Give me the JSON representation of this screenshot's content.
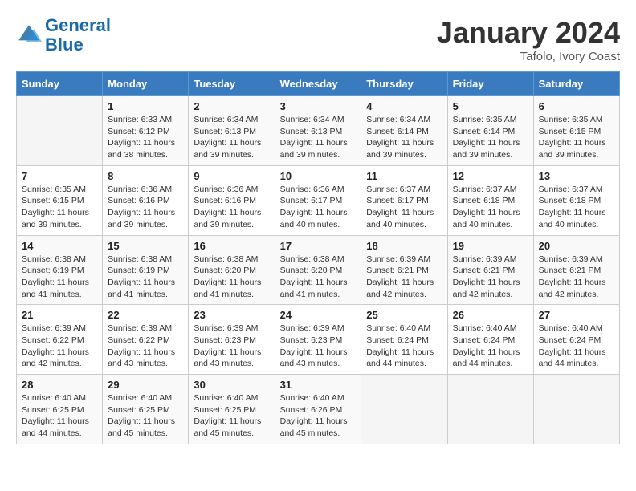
{
  "header": {
    "logo_line1": "General",
    "logo_line2": "Blue",
    "month_title": "January 2024",
    "subtitle": "Tafolo, Ivory Coast"
  },
  "days_of_week": [
    "Sunday",
    "Monday",
    "Tuesday",
    "Wednesday",
    "Thursday",
    "Friday",
    "Saturday"
  ],
  "weeks": [
    [
      {
        "day": "",
        "info": ""
      },
      {
        "day": "1",
        "info": "Sunrise: 6:33 AM\nSunset: 6:12 PM\nDaylight: 11 hours\nand 38 minutes."
      },
      {
        "day": "2",
        "info": "Sunrise: 6:34 AM\nSunset: 6:13 PM\nDaylight: 11 hours\nand 39 minutes."
      },
      {
        "day": "3",
        "info": "Sunrise: 6:34 AM\nSunset: 6:13 PM\nDaylight: 11 hours\nand 39 minutes."
      },
      {
        "day": "4",
        "info": "Sunrise: 6:34 AM\nSunset: 6:14 PM\nDaylight: 11 hours\nand 39 minutes."
      },
      {
        "day": "5",
        "info": "Sunrise: 6:35 AM\nSunset: 6:14 PM\nDaylight: 11 hours\nand 39 minutes."
      },
      {
        "day": "6",
        "info": "Sunrise: 6:35 AM\nSunset: 6:15 PM\nDaylight: 11 hours\nand 39 minutes."
      }
    ],
    [
      {
        "day": "7",
        "info": "Sunrise: 6:35 AM\nSunset: 6:15 PM\nDaylight: 11 hours\nand 39 minutes."
      },
      {
        "day": "8",
        "info": "Sunrise: 6:36 AM\nSunset: 6:16 PM\nDaylight: 11 hours\nand 39 minutes."
      },
      {
        "day": "9",
        "info": "Sunrise: 6:36 AM\nSunset: 6:16 PM\nDaylight: 11 hours\nand 39 minutes."
      },
      {
        "day": "10",
        "info": "Sunrise: 6:36 AM\nSunset: 6:17 PM\nDaylight: 11 hours\nand 40 minutes."
      },
      {
        "day": "11",
        "info": "Sunrise: 6:37 AM\nSunset: 6:17 PM\nDaylight: 11 hours\nand 40 minutes."
      },
      {
        "day": "12",
        "info": "Sunrise: 6:37 AM\nSunset: 6:18 PM\nDaylight: 11 hours\nand 40 minutes."
      },
      {
        "day": "13",
        "info": "Sunrise: 6:37 AM\nSunset: 6:18 PM\nDaylight: 11 hours\nand 40 minutes."
      }
    ],
    [
      {
        "day": "14",
        "info": "Sunrise: 6:38 AM\nSunset: 6:19 PM\nDaylight: 11 hours\nand 41 minutes."
      },
      {
        "day": "15",
        "info": "Sunrise: 6:38 AM\nSunset: 6:19 PM\nDaylight: 11 hours\nand 41 minutes."
      },
      {
        "day": "16",
        "info": "Sunrise: 6:38 AM\nSunset: 6:20 PM\nDaylight: 11 hours\nand 41 minutes."
      },
      {
        "day": "17",
        "info": "Sunrise: 6:38 AM\nSunset: 6:20 PM\nDaylight: 11 hours\nand 41 minutes."
      },
      {
        "day": "18",
        "info": "Sunrise: 6:39 AM\nSunset: 6:21 PM\nDaylight: 11 hours\nand 42 minutes."
      },
      {
        "day": "19",
        "info": "Sunrise: 6:39 AM\nSunset: 6:21 PM\nDaylight: 11 hours\nand 42 minutes."
      },
      {
        "day": "20",
        "info": "Sunrise: 6:39 AM\nSunset: 6:21 PM\nDaylight: 11 hours\nand 42 minutes."
      }
    ],
    [
      {
        "day": "21",
        "info": "Sunrise: 6:39 AM\nSunset: 6:22 PM\nDaylight: 11 hours\nand 42 minutes."
      },
      {
        "day": "22",
        "info": "Sunrise: 6:39 AM\nSunset: 6:22 PM\nDaylight: 11 hours\nand 43 minutes."
      },
      {
        "day": "23",
        "info": "Sunrise: 6:39 AM\nSunset: 6:23 PM\nDaylight: 11 hours\nand 43 minutes."
      },
      {
        "day": "24",
        "info": "Sunrise: 6:39 AM\nSunset: 6:23 PM\nDaylight: 11 hours\nand 43 minutes."
      },
      {
        "day": "25",
        "info": "Sunrise: 6:40 AM\nSunset: 6:24 PM\nDaylight: 11 hours\nand 44 minutes."
      },
      {
        "day": "26",
        "info": "Sunrise: 6:40 AM\nSunset: 6:24 PM\nDaylight: 11 hours\nand 44 minutes."
      },
      {
        "day": "27",
        "info": "Sunrise: 6:40 AM\nSunset: 6:24 PM\nDaylight: 11 hours\nand 44 minutes."
      }
    ],
    [
      {
        "day": "28",
        "info": "Sunrise: 6:40 AM\nSunset: 6:25 PM\nDaylight: 11 hours\nand 44 minutes."
      },
      {
        "day": "29",
        "info": "Sunrise: 6:40 AM\nSunset: 6:25 PM\nDaylight: 11 hours\nand 45 minutes."
      },
      {
        "day": "30",
        "info": "Sunrise: 6:40 AM\nSunset: 6:25 PM\nDaylight: 11 hours\nand 45 minutes."
      },
      {
        "day": "31",
        "info": "Sunrise: 6:40 AM\nSunset: 6:26 PM\nDaylight: 11 hours\nand 45 minutes."
      },
      {
        "day": "",
        "info": ""
      },
      {
        "day": "",
        "info": ""
      },
      {
        "day": "",
        "info": ""
      }
    ]
  ]
}
